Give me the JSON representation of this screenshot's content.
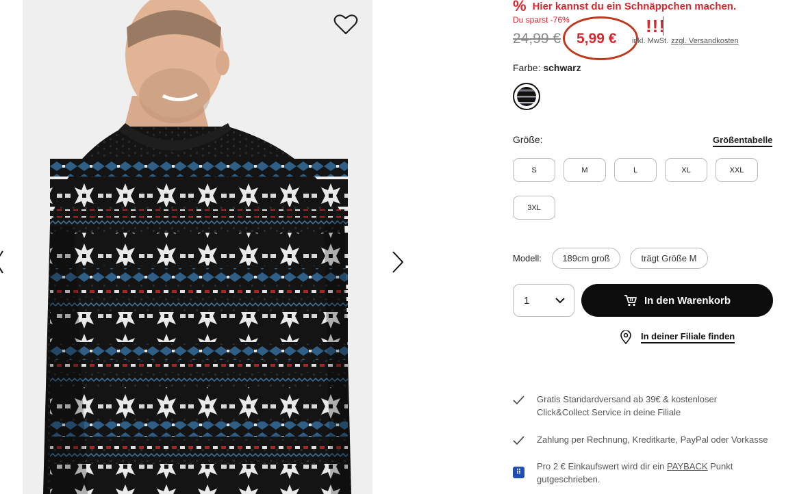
{
  "product": {
    "deal_text": "Hier kannst du ein Schnäppchen machen.",
    "deal_icon": "percent-icon",
    "savings": "Du sparst -76%",
    "old_price": "24,99 €",
    "new_price": "5,99 €",
    "annotation": "!!!",
    "tax_note": "inkl. MwSt.",
    "shipping_link": "zzgl. Versandkosten",
    "accent_color": "#d9262c"
  },
  "color": {
    "label": "Farbe:",
    "value": "schwarz"
  },
  "size": {
    "label": "Größe:",
    "chart_link": "Größentabelle",
    "options": [
      "S",
      "M",
      "L",
      "XL",
      "XXL",
      "3XL"
    ]
  },
  "model": {
    "label": "Modell:",
    "height": "189cm groß",
    "wears": "trägt Größe M"
  },
  "purchase": {
    "quantity": "1",
    "add_to_cart": "In den Warenkorb",
    "find_store": "In deiner Filiale finden"
  },
  "benefits": {
    "shipping_line1": "Gratis Standardversand ab 39€ & kostenloser",
    "shipping_line2": "Click&Collect Service in deine Filiale",
    "payment": "Zahlung per Rechnung, Kreditkarte, PayPal oder Vorkasse",
    "payback_pre": "Pro 2 € Einkaufswert wird dir ein ",
    "payback_link": "PAYBACK",
    "payback_post": " Punkt",
    "payback_line2": "gutgeschrieben."
  },
  "icons": {
    "wishlist": "heart-icon",
    "next": "chevron-right-icon",
    "prev": "chevron-left-icon",
    "cart": "cart-icon",
    "store": "location-pin-icon",
    "check": "check-icon",
    "payback": "payback-icon"
  }
}
